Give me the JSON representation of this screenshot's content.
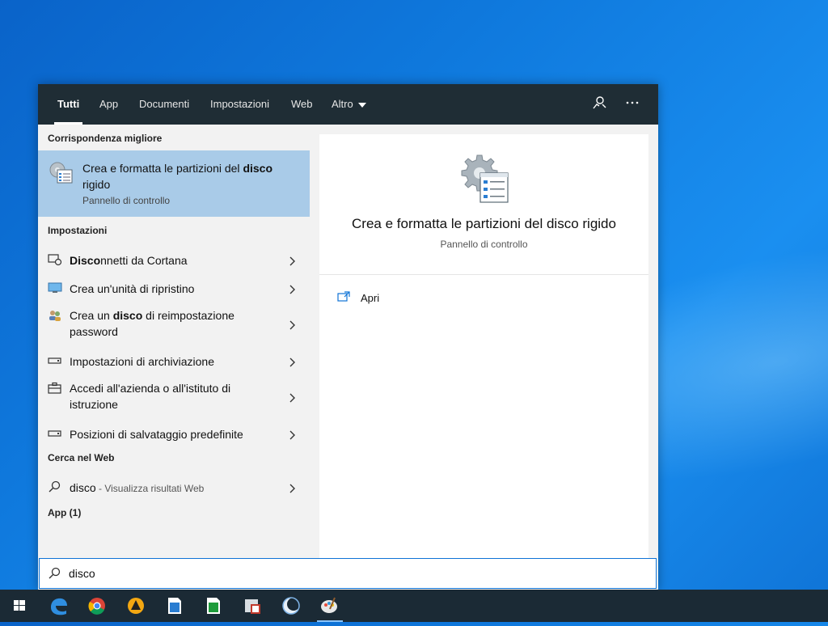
{
  "search": {
    "tabs": [
      {
        "label": "Tutti"
      },
      {
        "label": "App"
      },
      {
        "label": "Documenti"
      },
      {
        "label": "Impostazioni"
      },
      {
        "label": "Web"
      },
      {
        "label": "Altro"
      }
    ],
    "query": "disco"
  },
  "results": {
    "best_match_header": "Corrispondenza migliore",
    "best_match": {
      "title_pre": "Crea e formatta le partizioni del ",
      "title_bold": "disco",
      "title_post": " rigido",
      "subtitle": "Pannello di controllo"
    },
    "settings_header": "Impostazioni",
    "settings": [
      {
        "bold": "Disco",
        "rest": "nnetti da Cortana"
      },
      {
        "text": "Crea un'unità di ripristino"
      },
      {
        "pre": "Crea un ",
        "bold": "disco",
        "rest": " di reimpostazione password"
      },
      {
        "text": "Impostazioni di archiviazione"
      },
      {
        "text": "Accedi all'azienda o all'istituto di istruzione"
      },
      {
        "text": "Posizioni di salvataggio predefinite"
      }
    ],
    "web_header": "Cerca nel Web",
    "web": {
      "term": "disco",
      "hint": " - Visualizza risultati Web"
    },
    "apps_header": "App (1)"
  },
  "preview": {
    "title": "Crea e formatta le partizioni del disco rigido",
    "subtitle": "Pannello di controllo",
    "actions": [
      {
        "label": "Apri"
      }
    ]
  },
  "taskbar": {
    "items": [
      "start-icon",
      "edge-icon",
      "chrome-icon",
      "vlc-icon",
      "writer-icon",
      "calc-icon",
      "control-panel-icon",
      "app-icon",
      "paint-icon"
    ]
  },
  "colors": {
    "accent": "#0f73d6",
    "topbar": "#1f2d35",
    "selected": "#a9cbe8"
  }
}
